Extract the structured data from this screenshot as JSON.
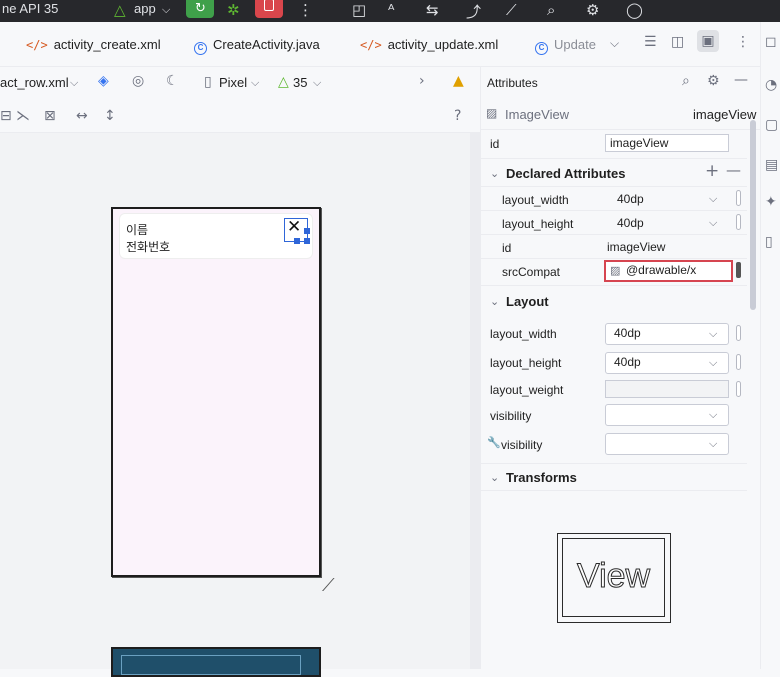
{
  "topbar": {
    "device_text": "ne API 35",
    "app_label": "app"
  },
  "tabs": [
    {
      "label": "activity_create.xml",
      "kind": "xml"
    },
    {
      "label": "CreateActivity.java",
      "kind": "class"
    },
    {
      "label": "activity_update.xml",
      "kind": "xml"
    },
    {
      "label": "Update",
      "kind": "class"
    }
  ],
  "design": {
    "file_name": "act_row.xml",
    "device": "Pixel",
    "api": "35",
    "help": "?"
  },
  "preview": {
    "name_label": "이름",
    "phone_label": "전화번호"
  },
  "attributes": {
    "title": "Attributes",
    "component_type": "ImageView",
    "component_id": "imageView",
    "id_label": "id",
    "id_value": "imageView",
    "declared_title": "Declared Attributes",
    "declared": [
      {
        "name": "layout_width",
        "value": "40dp"
      },
      {
        "name": "layout_height",
        "value": "40dp"
      },
      {
        "name": "id",
        "value": "imageView"
      },
      {
        "name": "srcCompat",
        "value": "@drawable/x"
      }
    ],
    "layout_title": "Layout",
    "layout": [
      {
        "name": "layout_width",
        "value": "40dp"
      },
      {
        "name": "layout_height",
        "value": "40dp"
      },
      {
        "name": "layout_weight",
        "value": ""
      },
      {
        "name": "visibility",
        "value": ""
      },
      {
        "name": "visibility",
        "value": ""
      }
    ],
    "transforms_title": "Transforms",
    "view_preview_label": "View"
  }
}
